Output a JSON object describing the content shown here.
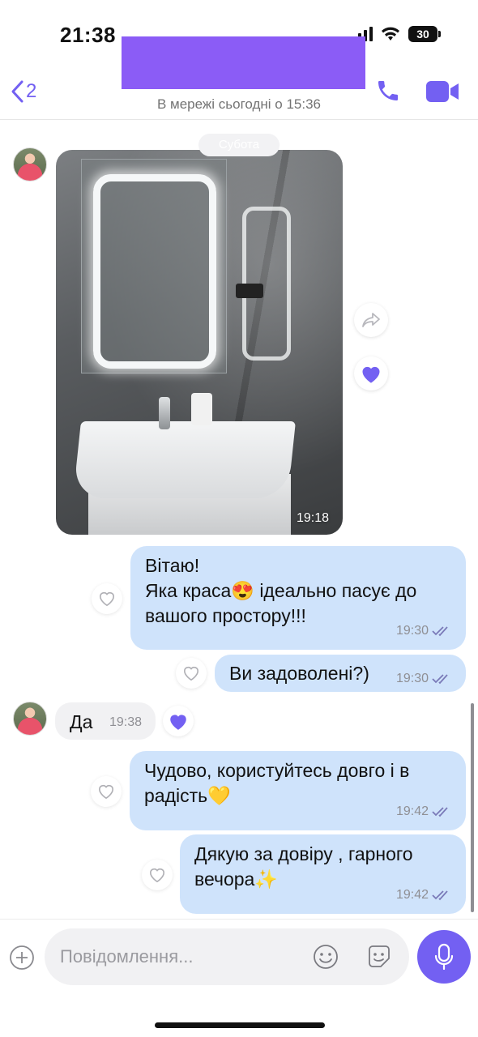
{
  "status_bar": {
    "time": "21:38",
    "battery": "30"
  },
  "header": {
    "back_count": "2",
    "presence": "В мережі сьогодні о 15:36",
    "accent_color": "#7360f2",
    "redaction_color": "#8b5cf6"
  },
  "chat": {
    "date_label": "Субота",
    "photo_message": {
      "time": "19:18",
      "description_icon": "photo"
    },
    "messages": [
      {
        "direction": "out",
        "lines": [
          "Вітаю!",
          "Яка краса😍 ідеально пасує до",
          "вашого простору!!!"
        ],
        "time": "19:30"
      },
      {
        "direction": "out",
        "lines": [
          "Ви задоволені?)"
        ],
        "time": "19:30"
      },
      {
        "direction": "in",
        "lines": [
          "Да"
        ],
        "time": "19:38"
      },
      {
        "direction": "out",
        "lines": [
          "Чудово, користуйтесь довго і в",
          "радість💛"
        ],
        "time": "19:42"
      },
      {
        "direction": "out",
        "lines": [
          "Дякую за довіру , гарного",
          "вечора✨"
        ],
        "time": "19:42"
      }
    ]
  },
  "composer": {
    "placeholder": "Повідомлення..."
  },
  "colors": {
    "outgoing_bubble": "#cfe3fb",
    "incoming_bubble": "#f1f1f3",
    "heart_filled": "#7360f2"
  }
}
